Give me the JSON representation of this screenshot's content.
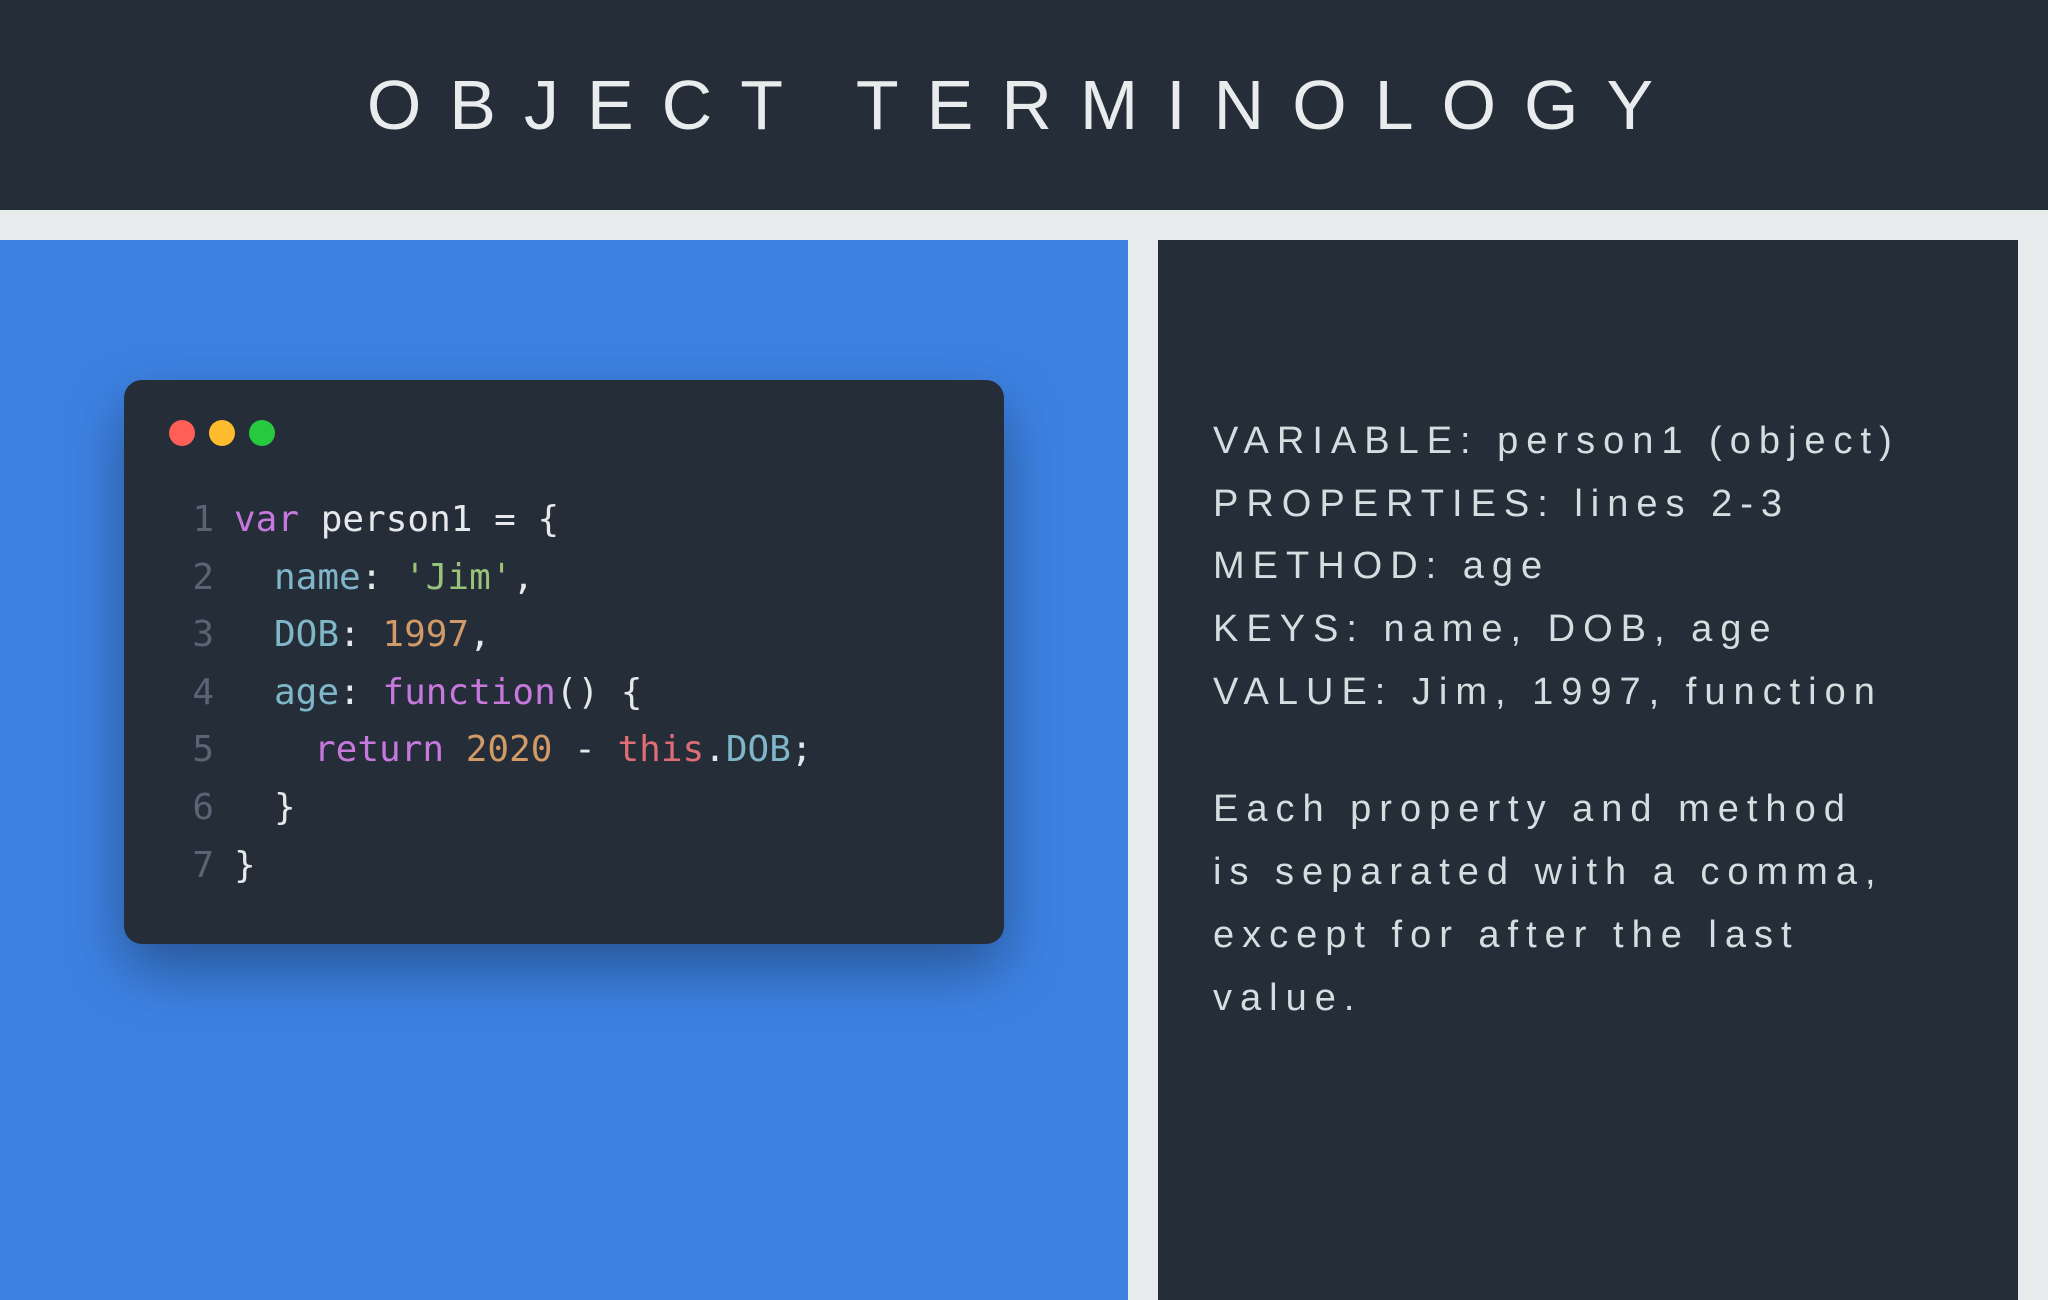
{
  "header": {
    "title": "OBJECT TERMINOLOGY"
  },
  "code": {
    "line1": {
      "num": "1",
      "kw": "var",
      "ident": " person1 ",
      "eq": "= {"
    },
    "line2": {
      "num": "2",
      "prop": "name",
      "colon": ": ",
      "str": "'Jim'",
      "comma": ","
    },
    "line3": {
      "num": "3",
      "prop": "DOB",
      "colon": ": ",
      "numval": "1997",
      "comma": ","
    },
    "line4": {
      "num": "4",
      "prop": "age",
      "colon": ": ",
      "fn": "function",
      "paren": "() {"
    },
    "line5": {
      "num": "5",
      "kw": "return",
      "sp": " ",
      "numval": "2020",
      "dash": " - ",
      "this": "this",
      "dot": ".",
      "dob": "DOB",
      "semi": ";"
    },
    "line6": {
      "num": "6",
      "brace": "}"
    },
    "line7": {
      "num": "7",
      "brace": "}"
    }
  },
  "terms": {
    "variable": "VARIABLE: person1 (object)",
    "properties": "PROPERTIES: lines 2-3",
    "method": "METHOD: age",
    "keys": "KEYS: name, DOB, age",
    "value": "VALUE: Jim, 1997, function"
  },
  "note": {
    "l1": "Each property and method",
    "l2": "is separated with a comma,",
    "l3": "except for after the last",
    "l4": "value."
  }
}
